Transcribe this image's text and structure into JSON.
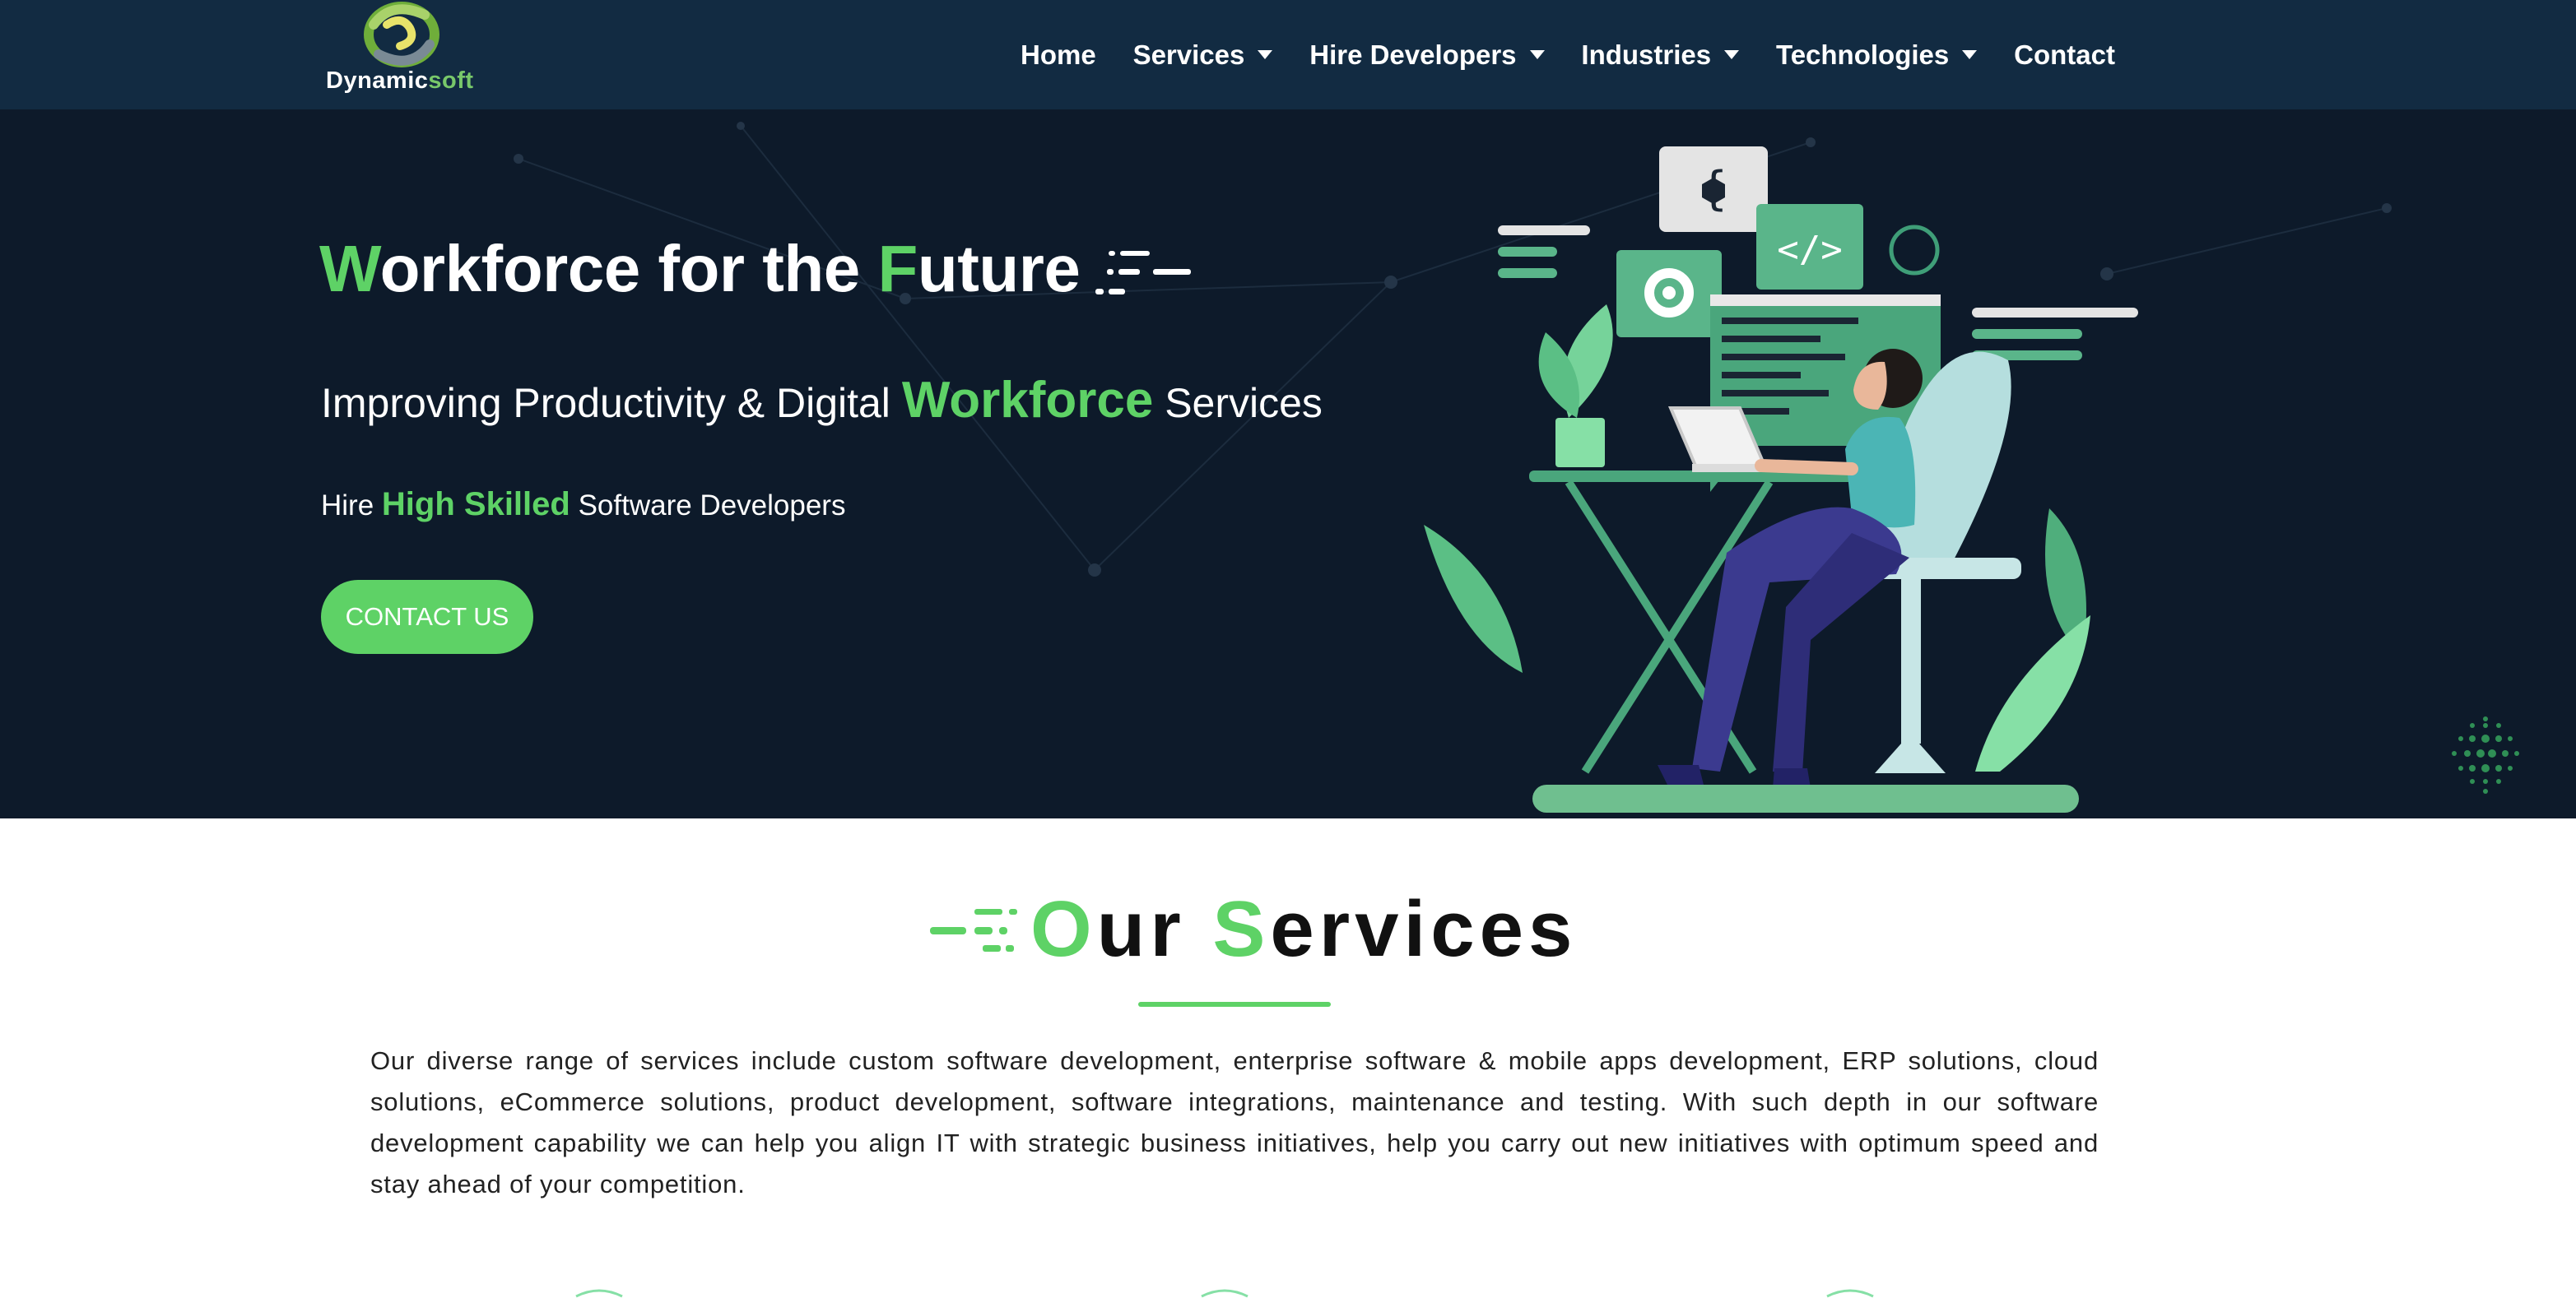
{
  "brand": {
    "name_part1": "Dynamic",
    "name_part2": "soft"
  },
  "nav": {
    "items": [
      {
        "label": "Home",
        "has_dropdown": false
      },
      {
        "label": "Services",
        "has_dropdown": true
      },
      {
        "label": "Hire Developers",
        "has_dropdown": true
      },
      {
        "label": "Industries",
        "has_dropdown": true
      },
      {
        "label": "Technologies",
        "has_dropdown": true
      },
      {
        "label": "Contact",
        "has_dropdown": false
      }
    ]
  },
  "hero": {
    "title_w": "W",
    "title_part1": "orkforce for the ",
    "title_f": "F",
    "title_part2": "uture",
    "subtitle_part1": "Improving Productivity & Digital ",
    "subtitle_highlight": "Workforce",
    "subtitle_part2": " Services",
    "hire_part1": "Hire ",
    "hire_highlight": "High Skilled",
    "hire_part2": " Software Developers",
    "cta_label": "CONTACT US"
  },
  "services": {
    "title_o": "O",
    "title_part1": "ur ",
    "title_s": "S",
    "title_part2": "ervices",
    "description": "Our diverse range of services include custom software development, enterprise software & mobile apps development, ERP solutions, cloud solutions, eCommerce solutions, product development, software integrations, maintenance and testing. With such depth in our software development capability we can help you align IT with strategic business initiatives, help you carry out new initiatives with optimum speed and stay ahead of your competition."
  },
  "colors": {
    "nav_bg": "#122b42",
    "hero_bg": "#0d1a2a",
    "accent": "#5ed266",
    "text_dark": "#111111"
  }
}
